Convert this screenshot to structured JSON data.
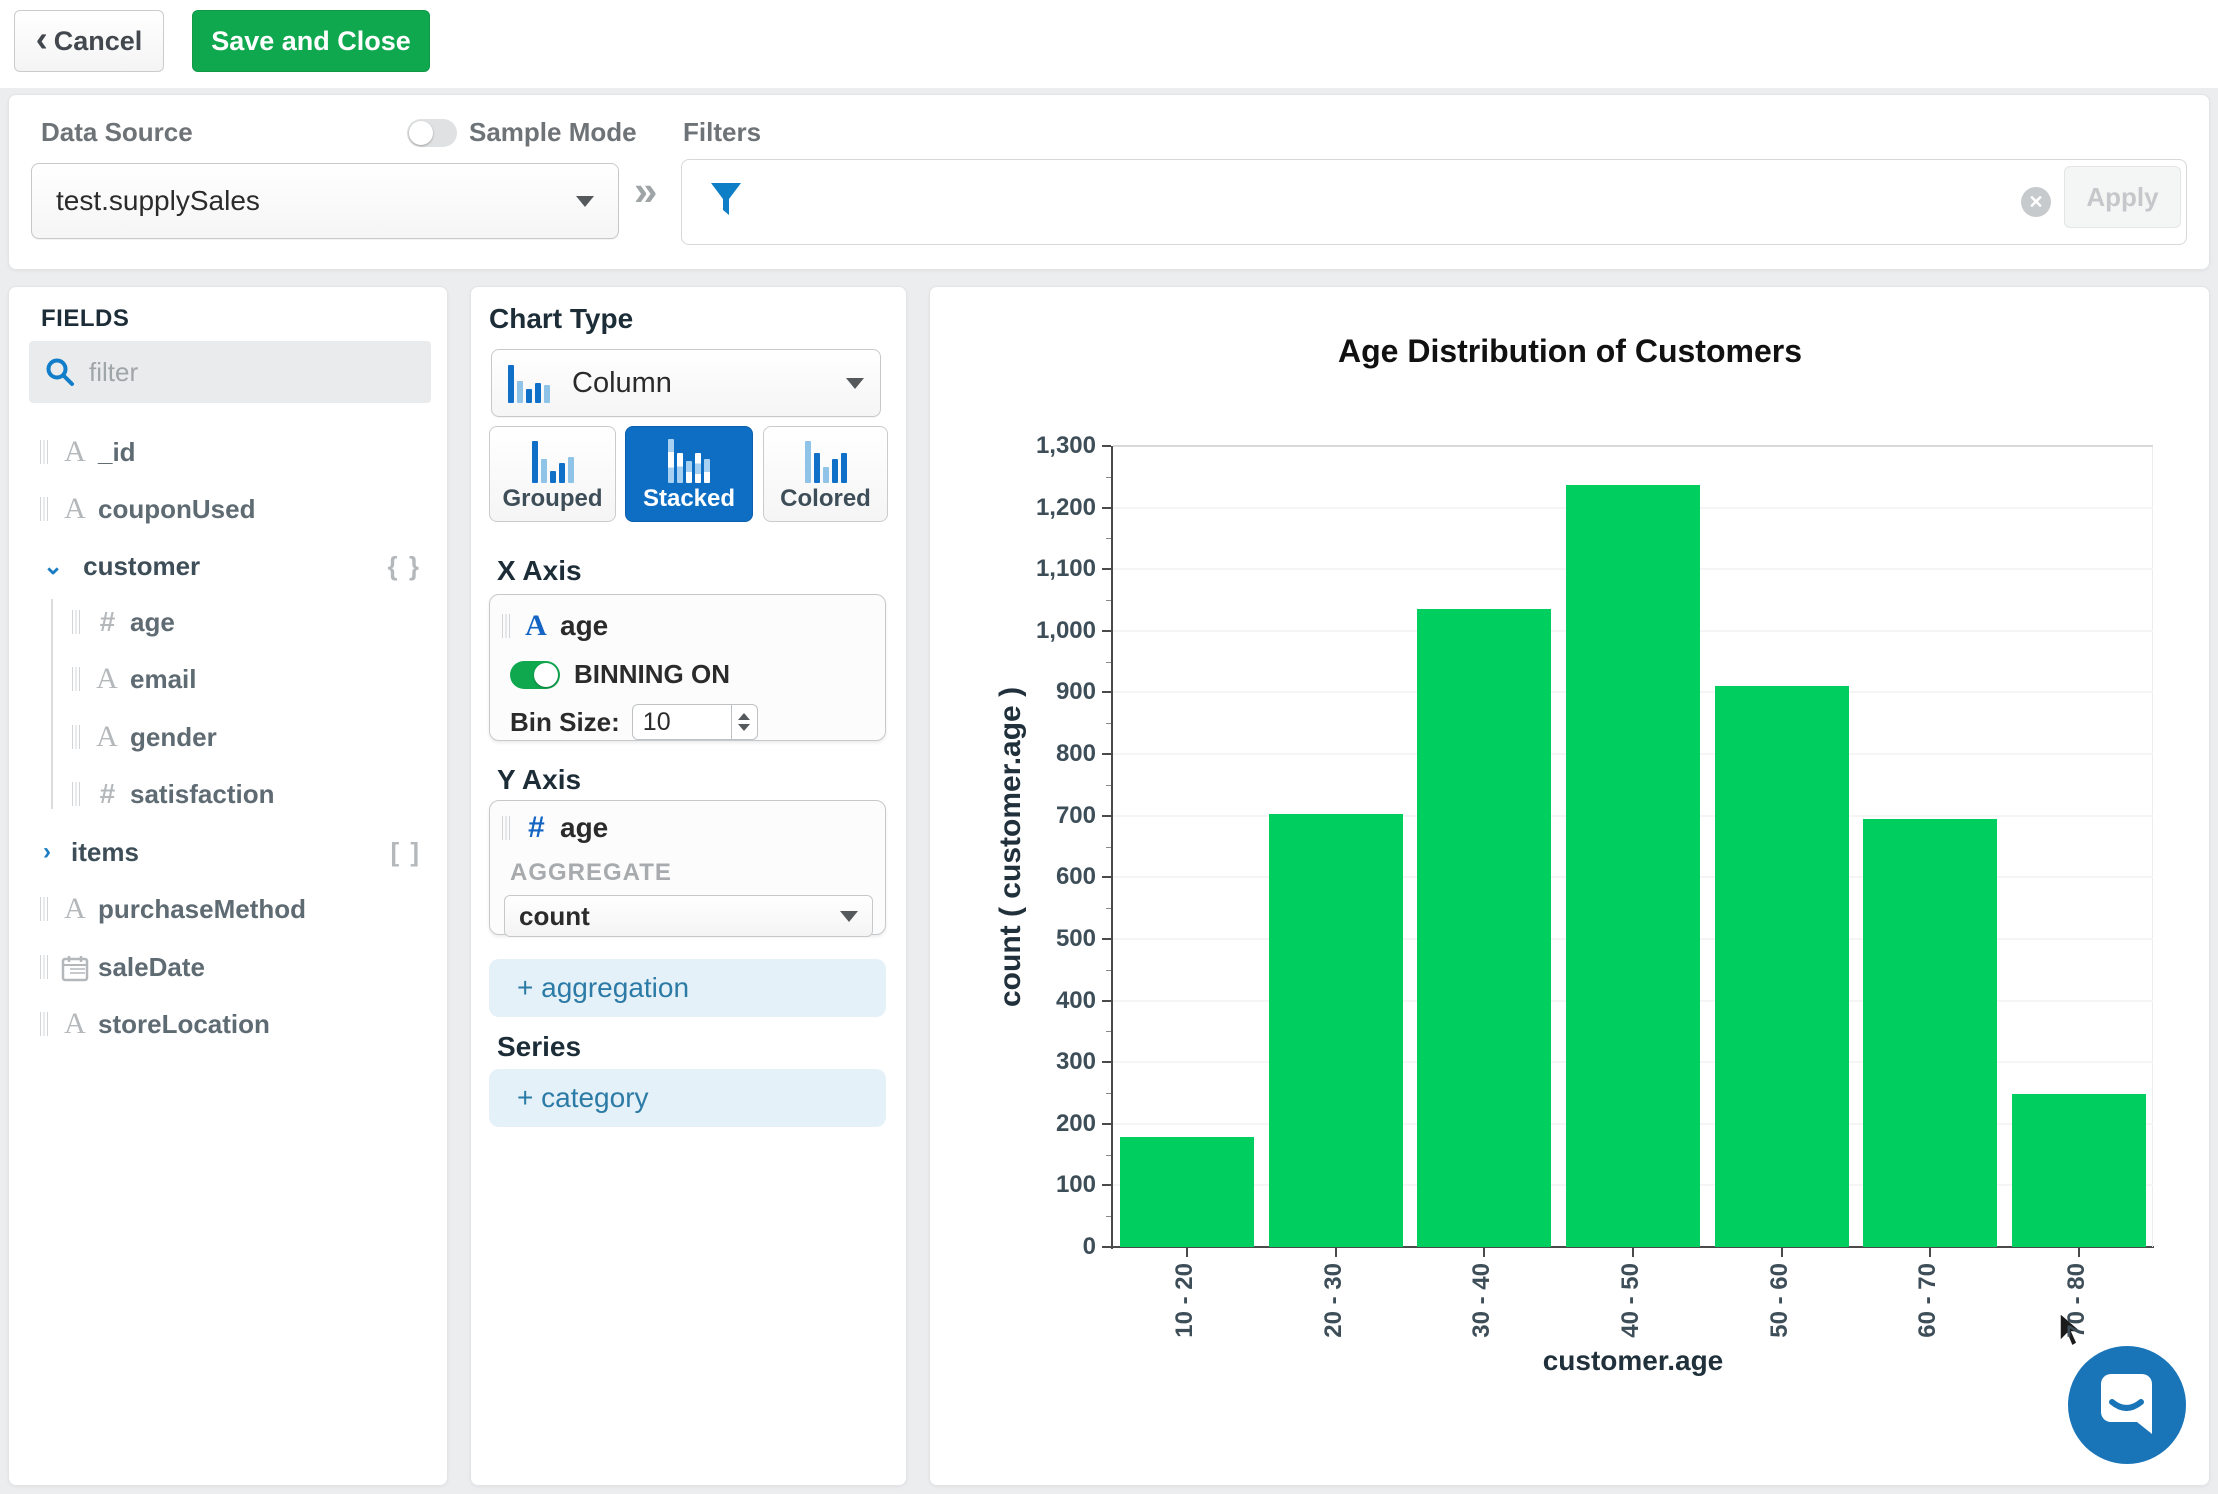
{
  "topbar": {
    "cancel_label": "Cancel",
    "save_label": "Save and Close"
  },
  "datasource": {
    "label": "Data Source",
    "value": "test.supplySales",
    "sample_mode_label": "Sample Mode",
    "filters_label": "Filters",
    "apply_label": "Apply"
  },
  "fields": {
    "header": "FIELDS",
    "filter_placeholder": "filter",
    "items": [
      {
        "label": "_id",
        "type": "string"
      },
      {
        "label": "couponUsed",
        "type": "string"
      },
      {
        "label": "customer",
        "type": "object",
        "expanded": true,
        "badge": "{ }"
      },
      {
        "label": "age",
        "type": "number",
        "parent": "customer"
      },
      {
        "label": "email",
        "type": "string",
        "parent": "customer"
      },
      {
        "label": "gender",
        "type": "string",
        "parent": "customer"
      },
      {
        "label": "satisfaction",
        "type": "number",
        "parent": "customer"
      },
      {
        "label": "items",
        "type": "array",
        "expanded": false,
        "badge": "[ ]"
      },
      {
        "label": "purchaseMethod",
        "type": "string"
      },
      {
        "label": "saleDate",
        "type": "date"
      },
      {
        "label": "storeLocation",
        "type": "string"
      }
    ]
  },
  "builder": {
    "chart_type_label": "Chart Type",
    "chart_type_value": "Column",
    "variants": [
      {
        "label": "Grouped"
      },
      {
        "label": "Stacked"
      },
      {
        "label": "Colored"
      }
    ],
    "selected_variant": "Stacked",
    "x_axis": {
      "label": "X Axis",
      "field": "age",
      "binning_label": "BINNING ON",
      "bin_size_label": "Bin Size:",
      "bin_size_value": "10"
    },
    "y_axis": {
      "label": "Y Axis",
      "field": "age",
      "aggregate_label": "AGGREGATE",
      "aggregate_value": "count"
    },
    "add_aggregation_label": "+ aggregation",
    "series_label": "Series",
    "add_category_label": "+ category"
  },
  "chart_data": {
    "type": "bar",
    "title": "Age Distribution of Customers",
    "xlabel": "customer.age",
    "ylabel": "count ( customer.age )",
    "categories": [
      "10 - 20",
      "20 - 30",
      "30 - 40",
      "40 - 50",
      "50 - 60",
      "60 - 70",
      "70 - 80"
    ],
    "values": [
      178,
      702,
      1036,
      1237,
      910,
      694,
      248
    ],
    "ylim": [
      0,
      1300
    ],
    "ytick_step": 100,
    "grid": "horizontal",
    "legend": "none",
    "bar_color": "#00CE5F"
  },
  "colors": {
    "brand_green": "#10A84F",
    "bar_green": "#00CE5F",
    "selected_blue": "#0D6EC4",
    "link_blue": "#1A7DC4",
    "light_blue_bg": "#E4F1F8",
    "chat_blue": "#1A75B8"
  }
}
